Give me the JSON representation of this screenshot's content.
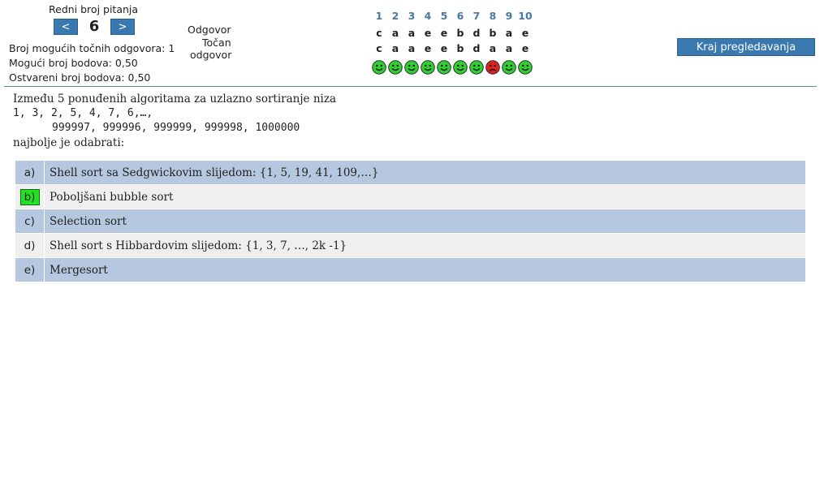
{
  "nav": {
    "label": "Redni broj pitanja",
    "prev": "<",
    "next": ">",
    "current": "6"
  },
  "info": {
    "possible_correct": "Broj mogućih točnih odgovora: 1",
    "possible_points": "Mogući broj bodova: 0,50",
    "earned_points": "Ostvareni broj bodova: 0,50"
  },
  "answer_labels": {
    "answer": "Odgovor",
    "correct_line1": "Točan",
    "correct_line2": "odgovor"
  },
  "grid": {
    "numbers": [
      "1",
      "2",
      "3",
      "4",
      "5",
      "6",
      "7",
      "8",
      "9",
      "10"
    ],
    "given": [
      "c",
      "a",
      "a",
      "e",
      "e",
      "b",
      "d",
      "b",
      "a",
      "e"
    ],
    "correct": [
      "c",
      "a",
      "a",
      "e",
      "e",
      "b",
      "d",
      "a",
      "a",
      "e"
    ],
    "status": [
      "ok",
      "ok",
      "ok",
      "ok",
      "ok",
      "ok",
      "ok",
      "wrong",
      "ok",
      "ok"
    ],
    "colors": {
      "ok": "#33cc33",
      "wrong": "#dd2222"
    }
  },
  "end_button": "Kraj pregledavanja",
  "question": {
    "line1": "Između 5 ponuđenih algoritama za uzlazno sortiranje niza",
    "line2": "1, 3, 2, 5, 4, 7, 6,…,",
    "line3": "999997, 999996, 999999, 999998, 1000000",
    "line4": "najbolje je odabrati:"
  },
  "options": [
    {
      "letter": "a)",
      "text": "Shell sort sa Sedgwickovim slijedom: {1, 5, 19, 41, 109,…}",
      "correct": false
    },
    {
      "letter": "b)",
      "text": "Poboljšani bubble sort",
      "correct": true
    },
    {
      "letter": "c)",
      "text": "Selection sort",
      "correct": false
    },
    {
      "letter": "d)",
      "text": "Shell sort s Hibbardovim slijedom: {1, 3, 7, …, 2k -1}",
      "correct": false
    },
    {
      "letter": "e)",
      "text": "Mergesort",
      "correct": false
    }
  ]
}
